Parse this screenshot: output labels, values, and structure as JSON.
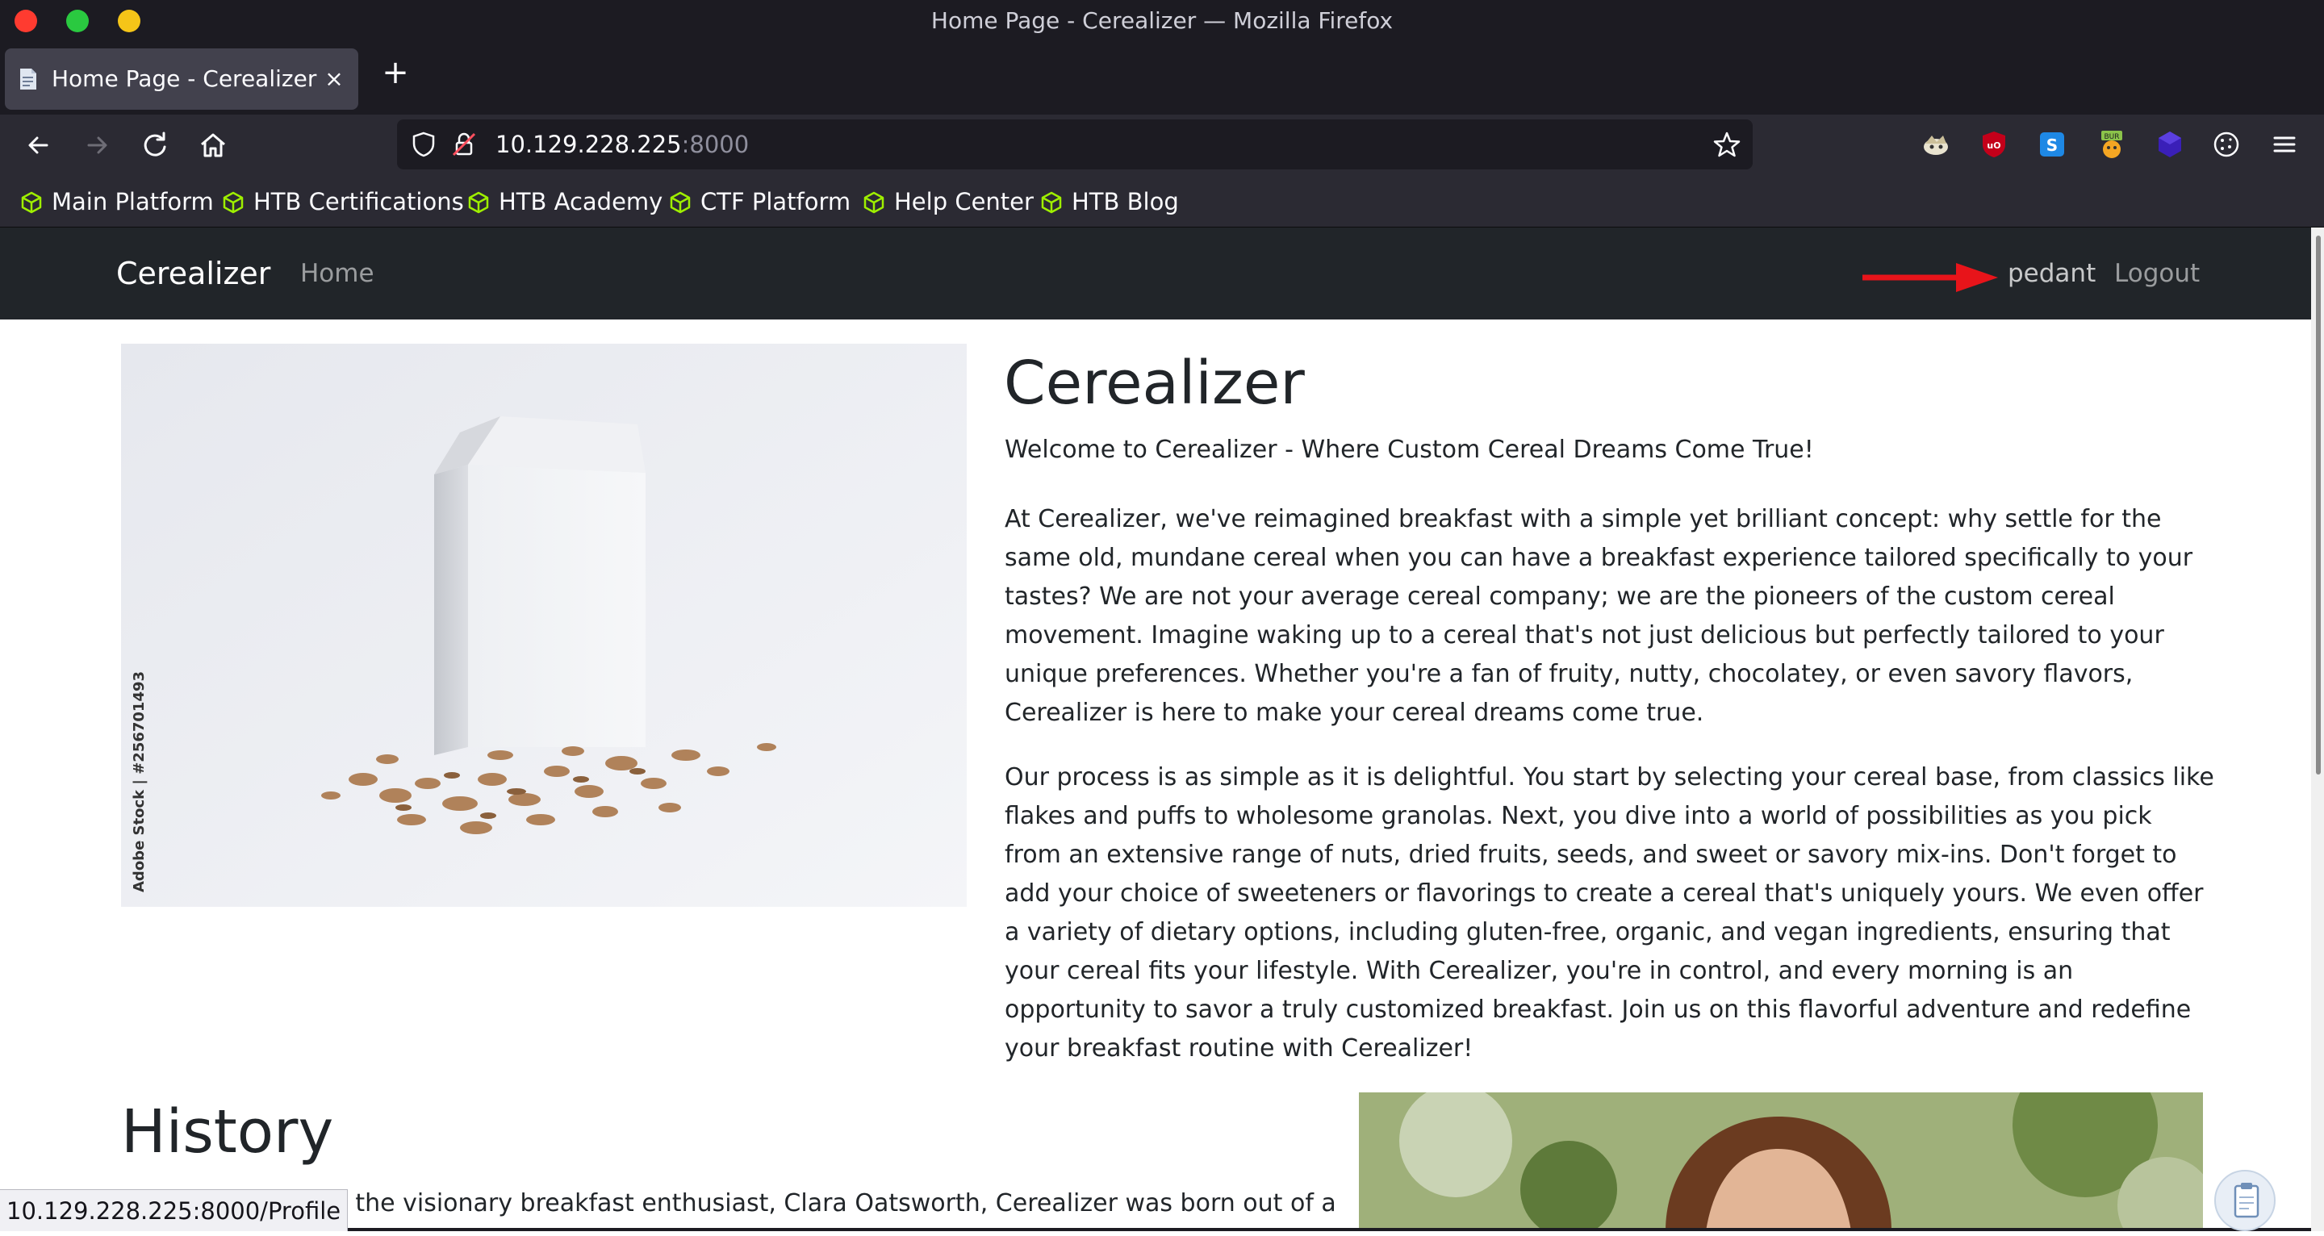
{
  "window": {
    "title": "Home Page - Cerealizer — Mozilla Firefox"
  },
  "tabs": [
    {
      "label": "Home Page - Cerealizer",
      "close": "×"
    }
  ],
  "new_tab": "+",
  "url": {
    "host": "10.129.228.225",
    "port": ":8000"
  },
  "bookmarks": [
    "Main Platform",
    "HTB Certifications",
    "HTB Academy",
    "CTF Platform",
    "Help Center",
    "HTB Blog"
  ],
  "site": {
    "brand": "Cerealizer",
    "nav_home": "Home",
    "user": "pedant",
    "logout": "Logout",
    "heading": "Cerealizer",
    "lead": "Welcome to Cerealizer - Where Custom Cereal Dreams Come True!",
    "p1": "At Cerealizer, we've reimagined breakfast with a simple yet brilliant concept: why settle for the same old, mundane cereal when you can have a breakfast experience tailored specifically to your tastes? We are not your average cereal company; we are the pioneers of the custom cereal movement. Imagine waking up to a cereal that's not just delicious but perfectly tailored to your unique preferences. Whether you're a fan of fruity, nutty, chocolatey, or even savory flavors, Cerealizer is here to make your cereal dreams come true.",
    "p2": "Our process is as simple as it is delightful. You start by selecting your cereal base, from classics like flakes and puffs to wholesome granolas. Next, you dive into a world of possibilities as you pick from an extensive range of nuts, dried fruits, seeds, and sweet or savory mix-ins. Don't forget to add your choice of sweeteners or flavorings to create a cereal that's uniquely yours. We even offer a variety of dietary options, including gluten-free, organic, and vegan ingredients, ensuring that your cereal fits your lifestyle. With Cerealizer, you're in control, and every morning is an opportunity to savor a truly customized breakfast. Join us on this flavorful adventure and redefine your breakfast routine with Cerealizer!",
    "history_heading": "History",
    "history_p": "by the visionary breakfast enthusiast, Clara Oatsworth, Cerealizer was born out of a",
    "image_caption": "Adobe Stock | #256701493"
  },
  "status_url": "10.129.228.225:8000/Profile",
  "colors": {
    "accent_arrow": "#e8141a",
    "site_nav_bg": "#212529",
    "bookmark_icon": "#9fef00"
  },
  "icons": [
    "back-icon",
    "forward-icon",
    "reload-icon",
    "home-icon",
    "shield-icon",
    "lock-icon",
    "star-icon",
    "menu-icon"
  ]
}
